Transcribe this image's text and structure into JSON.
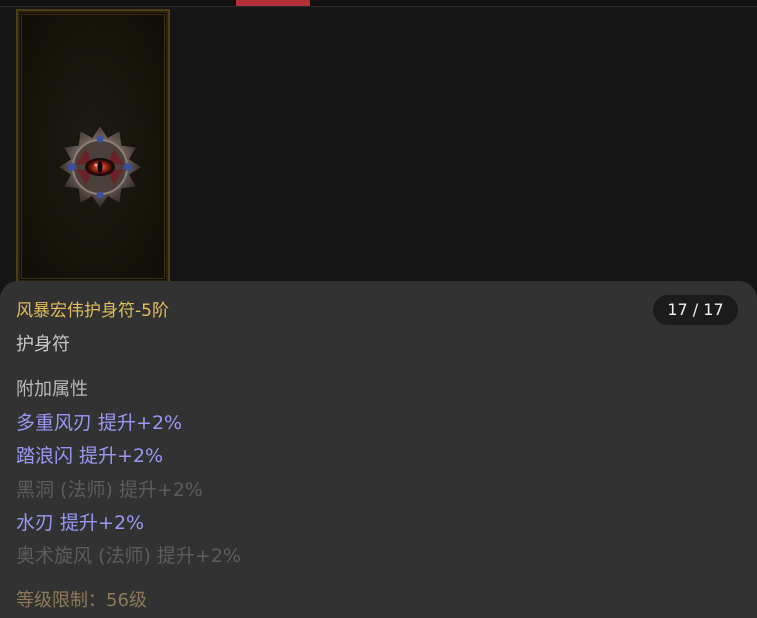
{
  "item": {
    "name": "风暴宏伟护身符-5阶",
    "count": "17 / 17",
    "type": "护身符",
    "section_title": "附加属性",
    "attributes": [
      {
        "text": "多重风刃 提升+2%",
        "active": true
      },
      {
        "text": "踏浪闪 提升+2%",
        "active": true
      },
      {
        "text": "黑洞 (法师) 提升+2%",
        "active": false
      },
      {
        "text": "水刃 提升+2%",
        "active": true
      },
      {
        "text": "奥术旋风 (法师) 提升+2%",
        "active": false
      }
    ],
    "level_requirement": "等级限制：56级"
  },
  "colors": {
    "name": "#e2bd5a",
    "active_attribute": "#9a98f5",
    "inactive_attribute": "#5c5c5c",
    "active_tab": "#b3303a",
    "level_text": "#8d7a58"
  },
  "icons": {
    "item_image": "amulet-icon"
  }
}
